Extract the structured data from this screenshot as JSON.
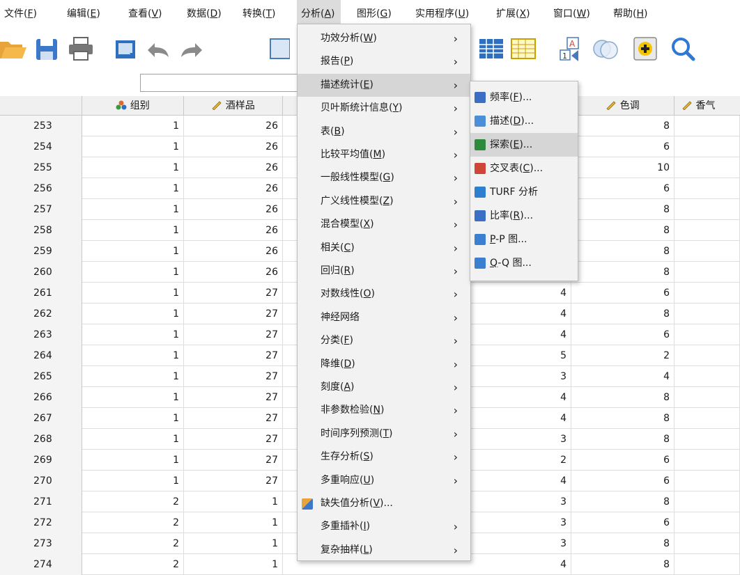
{
  "menubar": [
    {
      "label": "文件(",
      "key": "F",
      "tail": ")"
    },
    {
      "label": "编辑(",
      "key": "E",
      "tail": ")"
    },
    {
      "label": "查看(",
      "key": "V",
      "tail": ")"
    },
    {
      "label": "数据(",
      "key": "D",
      "tail": ")"
    },
    {
      "label": "转换(",
      "key": "T",
      "tail": ")"
    },
    {
      "label": "分析(",
      "key": "A",
      "tail": ")"
    },
    {
      "label": "图形(",
      "key": "G",
      "tail": ")"
    },
    {
      "label": "实用程序(",
      "key": "U",
      "tail": ")"
    },
    {
      "label": "扩展(",
      "key": "X",
      "tail": ")"
    },
    {
      "label": "窗口(",
      "key": "W",
      "tail": ")"
    },
    {
      "label": "帮助(",
      "key": "H",
      "tail": ")"
    }
  ],
  "toolbar": [
    "open-icon",
    "save-icon",
    "print-icon",
    "dialog-recall-icon",
    "undo-icon",
    "redo-icon",
    "goto-case-icon",
    "table-icon",
    "grid-icon",
    "value-labels-icon",
    "circles-icon",
    "add-icon",
    "search-icon"
  ],
  "grid": {
    "columns": [
      "组别",
      "酒样品",
      "色调",
      "香气"
    ],
    "rows": [
      {
        "n": "253",
        "group": "1",
        "sample": "26",
        "hidden": "",
        "color": "8"
      },
      {
        "n": "254",
        "group": "1",
        "sample": "26",
        "hidden": "",
        "color": "6"
      },
      {
        "n": "255",
        "group": "1",
        "sample": "26",
        "hidden": "",
        "color": "10"
      },
      {
        "n": "256",
        "group": "1",
        "sample": "26",
        "hidden": "",
        "color": "6"
      },
      {
        "n": "257",
        "group": "1",
        "sample": "26",
        "hidden": "",
        "color": "8"
      },
      {
        "n": "258",
        "group": "1",
        "sample": "26",
        "hidden": "",
        "color": "8"
      },
      {
        "n": "259",
        "group": "1",
        "sample": "26",
        "hidden": "",
        "color": "8"
      },
      {
        "n": "260",
        "group": "1",
        "sample": "26",
        "hidden": "",
        "color": "8"
      },
      {
        "n": "261",
        "group": "1",
        "sample": "27",
        "hidden": "4",
        "color": "6"
      },
      {
        "n": "262",
        "group": "1",
        "sample": "27",
        "hidden": "4",
        "color": "8"
      },
      {
        "n": "263",
        "group": "1",
        "sample": "27",
        "hidden": "4",
        "color": "6"
      },
      {
        "n": "264",
        "group": "1",
        "sample": "27",
        "hidden": "5",
        "color": "2"
      },
      {
        "n": "265",
        "group": "1",
        "sample": "27",
        "hidden": "3",
        "color": "4"
      },
      {
        "n": "266",
        "group": "1",
        "sample": "27",
        "hidden": "4",
        "color": "8"
      },
      {
        "n": "267",
        "group": "1",
        "sample": "27",
        "hidden": "4",
        "color": "8"
      },
      {
        "n": "268",
        "group": "1",
        "sample": "27",
        "hidden": "3",
        "color": "8"
      },
      {
        "n": "269",
        "group": "1",
        "sample": "27",
        "hidden": "2",
        "color": "6"
      },
      {
        "n": "270",
        "group": "1",
        "sample": "27",
        "hidden": "4",
        "color": "6"
      },
      {
        "n": "271",
        "group": "2",
        "sample": "1",
        "hidden": "3",
        "color": "8"
      },
      {
        "n": "272",
        "group": "2",
        "sample": "1",
        "hidden": "3",
        "color": "6"
      },
      {
        "n": "273",
        "group": "2",
        "sample": "1",
        "hidden": "3",
        "color": "8"
      },
      {
        "n": "274",
        "group": "2",
        "sample": "1",
        "hidden": "4",
        "color": "8"
      }
    ]
  },
  "analyze_menu": [
    {
      "label": "功效分析(",
      "key": "W",
      "tail": ")",
      "arrow": true
    },
    {
      "label": "报告(",
      "key": "P",
      "tail": ")",
      "arrow": true
    },
    {
      "label": "描述统计(",
      "key": "E",
      "tail": ")",
      "arrow": true,
      "highlighted": true
    },
    {
      "label": "贝叶斯统计信息(",
      "key": "Y",
      "tail": ")",
      "arrow": true
    },
    {
      "label": "表(",
      "key": "B",
      "tail": ")",
      "arrow": true
    },
    {
      "label": "比较平均值(",
      "key": "M",
      "tail": ")",
      "arrow": true
    },
    {
      "label": "一般线性模型(",
      "key": "G",
      "tail": ")",
      "arrow": true
    },
    {
      "label": "广义线性模型(",
      "key": "Z",
      "tail": ")",
      "arrow": true
    },
    {
      "label": "混合模型(",
      "key": "X",
      "tail": ")",
      "arrow": true
    },
    {
      "label": "相关(",
      "key": "C",
      "tail": ")",
      "arrow": true
    },
    {
      "label": "回归(",
      "key": "R",
      "tail": ")",
      "arrow": true
    },
    {
      "label": "对数线性(",
      "key": "O",
      "tail": ")",
      "arrow": true
    },
    {
      "label": "神经网络",
      "key": "",
      "tail": "",
      "arrow": true
    },
    {
      "label": "分类(",
      "key": "F",
      "tail": ")",
      "arrow": true
    },
    {
      "label": "降维(",
      "key": "D",
      "tail": ")",
      "arrow": true
    },
    {
      "label": "刻度(",
      "key": "A",
      "tail": ")",
      "arrow": true
    },
    {
      "label": "非参数检验(",
      "key": "N",
      "tail": ")",
      "arrow": true
    },
    {
      "label": "时间序列预测(",
      "key": "T",
      "tail": ")",
      "arrow": true
    },
    {
      "label": "生存分析(",
      "key": "S",
      "tail": ")",
      "arrow": true
    },
    {
      "label": "多重响应(",
      "key": "U",
      "tail": ")",
      "arrow": true
    },
    {
      "label": "缺失值分析(",
      "key": "V",
      "tail": ")...",
      "arrow": false,
      "icon": "missing-values-icon"
    },
    {
      "label": "多重插补(",
      "key": "I",
      "tail": ")",
      "arrow": true
    },
    {
      "label": "复杂抽样(",
      "key": "L",
      "tail": ")",
      "arrow": true
    }
  ],
  "descriptive_submenu": [
    {
      "label": "频率(",
      "key": "F",
      "tail": ")...",
      "icon": "frequencies-icon",
      "icon_color": "#3a6fc4"
    },
    {
      "label": "描述(",
      "key": "D",
      "tail": ")...",
      "icon": "descriptives-icon",
      "icon_color": "#4a8fd8"
    },
    {
      "label": "探索(",
      "key": "E",
      "tail": ")...",
      "icon": "explore-icon",
      "icon_color": "#2e8b3e",
      "highlighted": true
    },
    {
      "label": "交叉表(",
      "key": "C",
      "tail": ")...",
      "icon": "crosstabs-icon",
      "icon_color": "#d0453a"
    },
    {
      "label": "TURF 分析",
      "key": "",
      "tail": "",
      "icon": "turf-icon",
      "icon_color": "#2f7fd1"
    },
    {
      "label": "比率(",
      "key": "R",
      "tail": ")...",
      "icon": "ratio-icon",
      "icon_color": "#3a6fc4"
    },
    {
      "label": "",
      "key": "P",
      "tail": "-P 图...",
      "icon": "pp-plot-icon",
      "icon_color": "#3a7fd0"
    },
    {
      "label": "",
      "key": "Q",
      "tail": "-Q 图...",
      "icon": "qq-plot-icon",
      "icon_color": "#3a7fd0"
    }
  ]
}
